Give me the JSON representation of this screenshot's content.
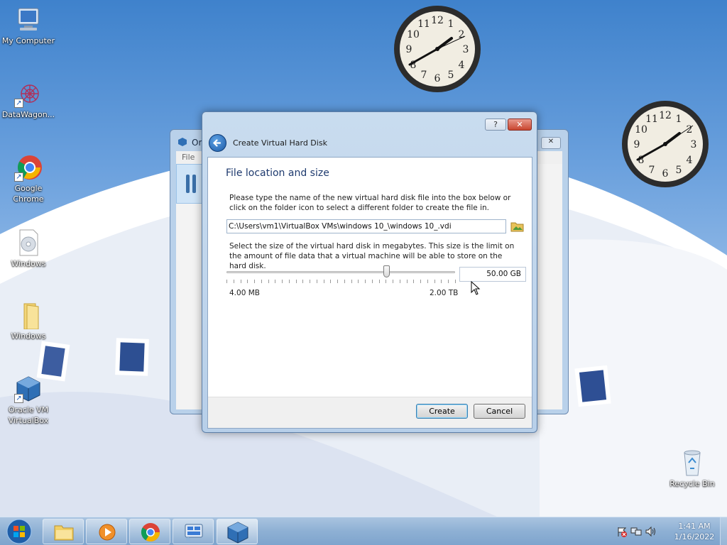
{
  "desktop": {
    "icons": [
      {
        "label": "My Computer"
      },
      {
        "label": "DataWagon..."
      },
      {
        "label": "Google Chrome"
      },
      {
        "label": "Windows"
      },
      {
        "label": "Windows"
      },
      {
        "label": "Oracle VM VirtualBox"
      },
      {
        "label": "Recycle Bin"
      }
    ]
  },
  "back_window": {
    "title_fragment": "Ora",
    "menu_fragment": "File"
  },
  "dialog": {
    "title": "Create Virtual Hard Disk",
    "help_symbol": "?",
    "close_symbol": "✕",
    "heading": "File location and size",
    "instruction1": "Please type the name of the new virtual hard disk file into the box below or click on the folder icon to select a different folder to create the file in.",
    "file_path": "C:\\Users\\vm1\\VirtualBox VMs\\windows 10_\\windows 10_.vdi",
    "instruction2": "Select the size of the virtual hard disk in megabytes. This size is the limit on the amount of file data that a virtual machine will be able to store on the hard disk.",
    "size_value": "50.00 GB",
    "slider_min": "4.00 MB",
    "slider_max": "2.00 TB",
    "slider_level": 0.7,
    "create_label": "Create",
    "cancel_label": "Cancel"
  },
  "taskbar": {
    "time": "1:41 AM",
    "date": "1/16/2022"
  }
}
